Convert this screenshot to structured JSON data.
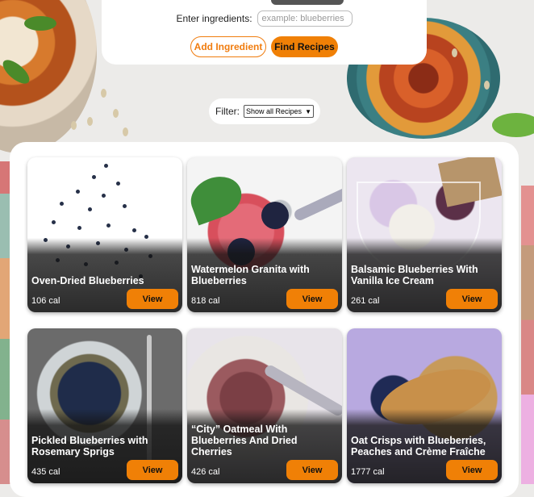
{
  "search": {
    "ingredients_label": "Enter ingredients:",
    "ingredients_placeholder": "example: blueberries",
    "add_button": "Add Ingredient",
    "find_button": "Find Recipes"
  },
  "filter": {
    "label": "Filter:",
    "selected": "Show all Recipes"
  },
  "recipes": [
    {
      "title": "Oven-Dried Blueberries",
      "calories": "106 cal",
      "view": "View"
    },
    {
      "title": "Watermelon Granita with Blueberries",
      "calories": "818 cal",
      "view": "View"
    },
    {
      "title": "Balsamic Blueberries With Vanilla Ice Cream",
      "calories": "261 cal",
      "view": "View"
    },
    {
      "title": "Pickled Blueberries with Rosemary Sprigs",
      "calories": "435 cal",
      "view": "View"
    },
    {
      "title": "“City” Oatmeal With Blueberries And Dried Cherries",
      "calories": "426 cal",
      "view": "View"
    },
    {
      "title": "Oat Crisps with Blueberries, Peaches and Crème Fraîche",
      "calories": "1777 cal",
      "view": "View"
    }
  ],
  "colors": {
    "accent": "#f08006",
    "panel": "#ffffff",
    "background": "#ecebe9"
  }
}
